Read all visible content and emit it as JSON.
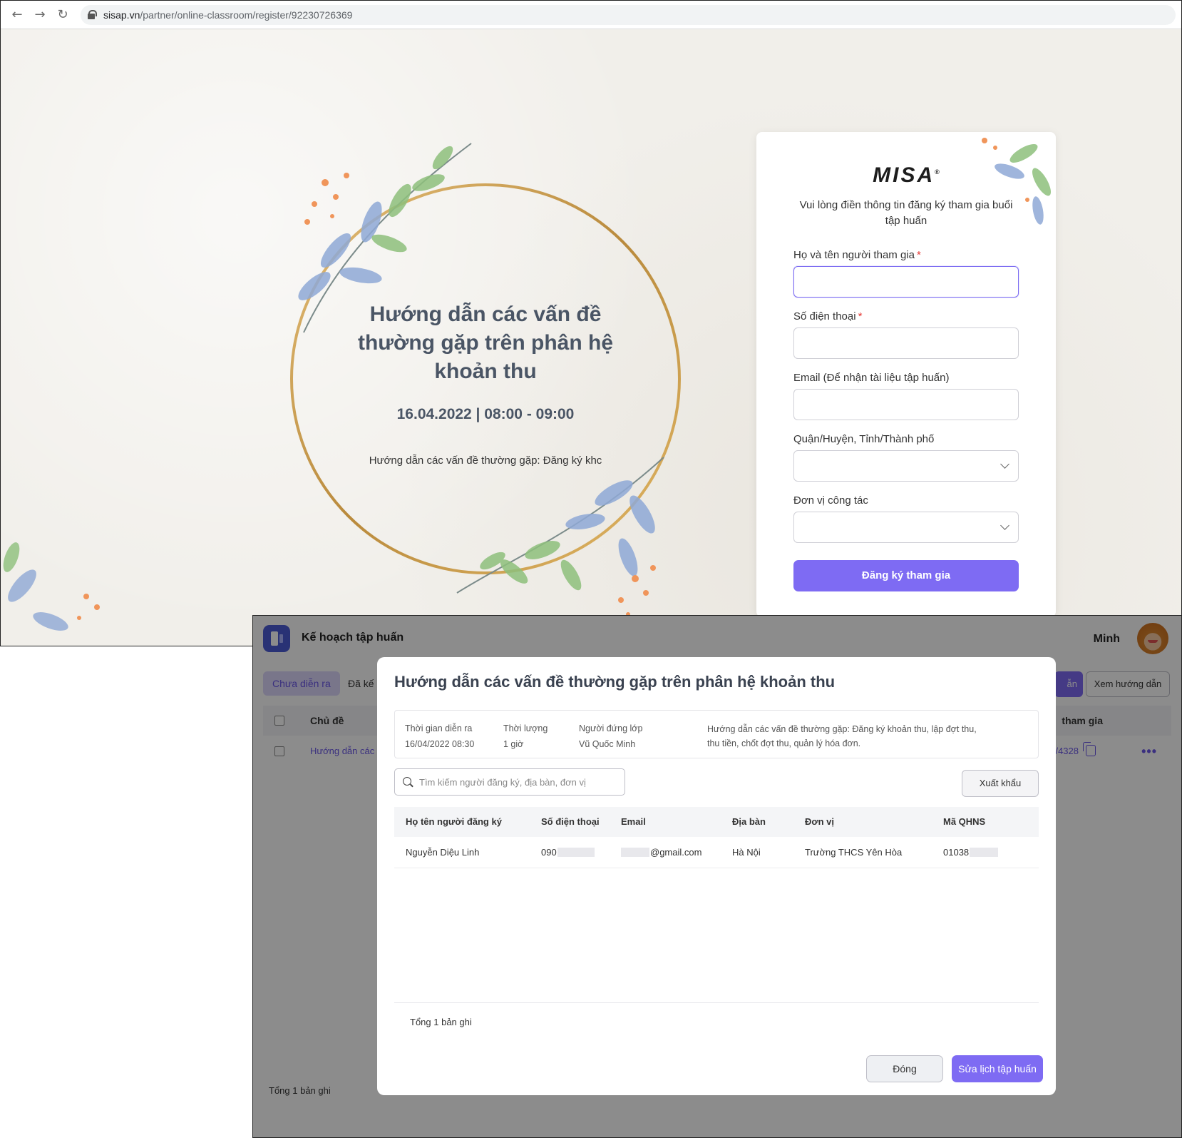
{
  "browser": {
    "url_domain": "sisap.vn",
    "url_path": "/partner/online-classroom/register/92230726369"
  },
  "event": {
    "title": "Hướng dẫn các vấn đề thường gặp trên phân hệ khoản thu",
    "date_time": "16.04.2022 | 08:00 - 09:00",
    "description": "Hướng dẫn các vấn đề thường gặp: Đăng ký khc"
  },
  "form": {
    "logo_text": "MISA",
    "intro": "Vui lòng điền thông tin đăng ký tham gia buổi tập huấn",
    "name_label": "Họ và tên người tham gia",
    "phone_label": "Số điện thoại",
    "email_label": "Email (Để nhận tài liệu tập huấn)",
    "district_label": "Quận/Huyện, Tỉnh/Thành phố",
    "unit_label": "Đơn vị công tác",
    "required_mark": "*",
    "submit_label": "Đăng ký tham gia"
  },
  "app": {
    "title": "Kế hoạch tập huấn",
    "user_name": "Minh",
    "tabs": [
      "Chưa diễn ra",
      "Đã kế"
    ],
    "btn_purple_partial": "ẫn",
    "btn_view_guide": "Xem hướng dẫn",
    "list_col_topic": "Chủ đề",
    "list_col_join": "tham gia",
    "list_row_topic": "Hướng dẫn các",
    "list_row_link": "vn/4328",
    "more_label": "•••",
    "footer_total": "Tổng 1 bản ghi"
  },
  "modal": {
    "title": "Hướng dẫn các vấn đề thường gặp trên phân hệ khoản thu",
    "info": {
      "time_label": "Thời gian diễn ra",
      "time_value": "16/04/2022 08:30",
      "duration_label": "Thời lượng",
      "duration_value": "1 giờ",
      "teacher_label": "Người đứng lớp",
      "teacher_value": "Vũ Quốc Minh",
      "description_line1": "Hướng dẫn các vấn đề thường gặp: Đăng ký khoản thu, lập đợt thu,",
      "description_line2": "thu tiền, chốt đợt thu, quản lý hóa đơn."
    },
    "search_placeholder": "Tìm kiếm người đăng ký, địa bàn, đơn vị",
    "export_label": "Xuất khẩu",
    "columns": [
      "Họ tên người đăng ký",
      "Số điện thoại",
      "Email",
      "Địa bàn",
      "Đơn vị",
      "Mã QHNS"
    ],
    "rows": [
      {
        "name": "Nguyễn Diệu Linh",
        "phone": "090",
        "email": "@gmail.com",
        "area": "Hà Nội",
        "unit": "Trường THCS Yên Hòa",
        "code": "01038"
      }
    ],
    "total": "Tổng 1 bản ghi",
    "close_label": "Đóng",
    "edit_label": "Sửa lịch tập huấn"
  },
  "colors": {
    "accent": "#7e6bf3",
    "link": "#6a57e8",
    "title": "#4a5565"
  }
}
